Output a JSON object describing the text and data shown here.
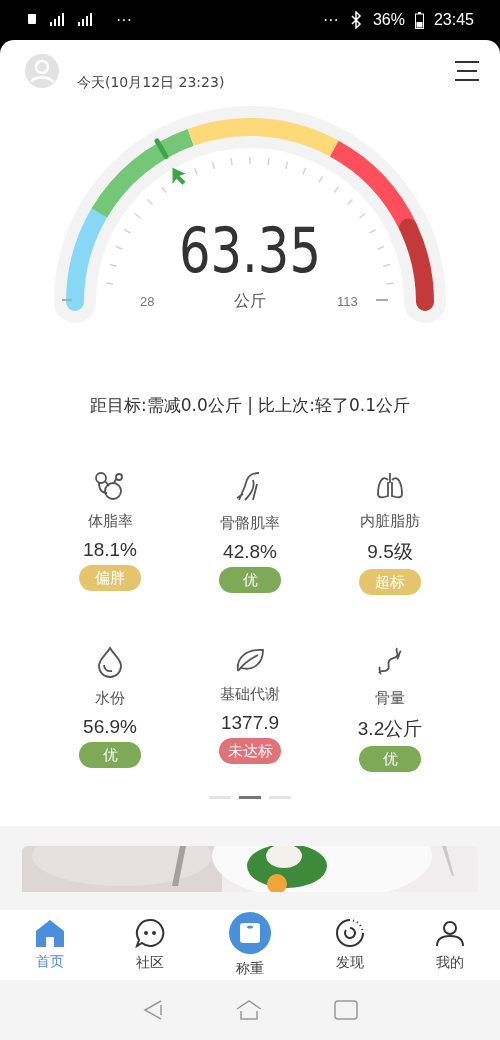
{
  "status_bar": {
    "left_more": "···",
    "right_more": "···",
    "battery": "36%",
    "time": "23:45"
  },
  "header": {
    "date": "今天(10月12日 23:23)"
  },
  "gauge": {
    "value": "63.35",
    "unit": "公斤",
    "min": "28",
    "max": "113",
    "segments": [
      {
        "color": "#86d8f5"
      },
      {
        "color": "#74c776"
      },
      {
        "color": "#fdd97a"
      },
      {
        "color": "#ff4f5c"
      },
      {
        "color": "#c43a3a"
      }
    ]
  },
  "summary": "距目标:需减0.0公斤 | 比上次:轻了0.1公斤",
  "metrics": [
    {
      "label": "体脂率",
      "value": "18.1%",
      "badge": "偏胖",
      "color": "#e4c56e"
    },
    {
      "label": "骨骼肌率",
      "value": "42.8%",
      "badge": "优",
      "color": "#7ea957"
    },
    {
      "label": "内脏脂肪",
      "value": "9.5级",
      "badge": "超标",
      "color": "#e4c56e"
    },
    {
      "label": "水份",
      "value": "56.9%",
      "badge": "优",
      "color": "#7ea957"
    },
    {
      "label": "基础代谢",
      "value": "1377.9",
      "badge": "未达标",
      "color": "#e0727a"
    },
    {
      "label": "骨量",
      "value": "3.2公斤",
      "badge": "优",
      "color": "#7ea957"
    }
  ],
  "pager": [
    {
      "selected": false
    },
    {
      "selected": true
    },
    {
      "selected": false
    }
  ],
  "tabs": [
    {
      "label": "首页",
      "selected": true
    },
    {
      "label": "社区",
      "selected": false
    },
    {
      "label": "称重",
      "selected": false
    },
    {
      "label": "发现",
      "selected": false
    },
    {
      "label": "我的",
      "selected": false
    }
  ]
}
